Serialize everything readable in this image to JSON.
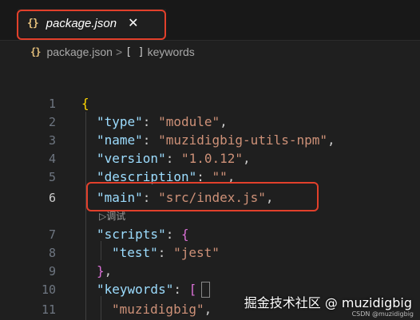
{
  "tab": {
    "icon": "{}",
    "label": "package.json",
    "close": "✕"
  },
  "breadcrumb": {
    "file_icon": "{}",
    "file": "package.json",
    "separator": ">",
    "node_icon": "[ ]",
    "node": "keywords"
  },
  "editor": {
    "line_numbers": [
      "1",
      "2",
      "3",
      "4",
      "5",
      "6",
      "7",
      "8",
      "9",
      "10",
      "11"
    ],
    "codelens": "▷调试",
    "lines": {
      "l1_open": "{",
      "type_key": "\"type\"",
      "type_val": "\"module\"",
      "name_key": "\"name\"",
      "name_val": "\"muzidigbig-utils-npm\"",
      "version_key": "\"version\"",
      "version_val": "\"1.0.12\"",
      "description_key": "\"description\"",
      "description_val": "\"\"",
      "main_key": "\"main\"",
      "main_val": "\"src/index.js\"",
      "scripts_key": "\"scripts\"",
      "scripts_open": "{",
      "test_key": "\"test\"",
      "test_val": "\"jest\"",
      "scripts_close": "}",
      "keywords_key": "\"keywords\"",
      "keywords_open": "[",
      "keyword1": "\"muzidigbig\"",
      "colon": ": ",
      "comma": ","
    }
  },
  "watermark": {
    "text": "掘金技术社区 @ muzidigbig",
    "small": "CSDN @muzidigbig"
  },
  "colors": {
    "highlight": "#e2402b",
    "key": "#9cdcfe",
    "string": "#ce9178",
    "bracket_level1": "#ffd700",
    "bracket_level2": "#da70d6",
    "bracket_level3": "#179fff"
  }
}
